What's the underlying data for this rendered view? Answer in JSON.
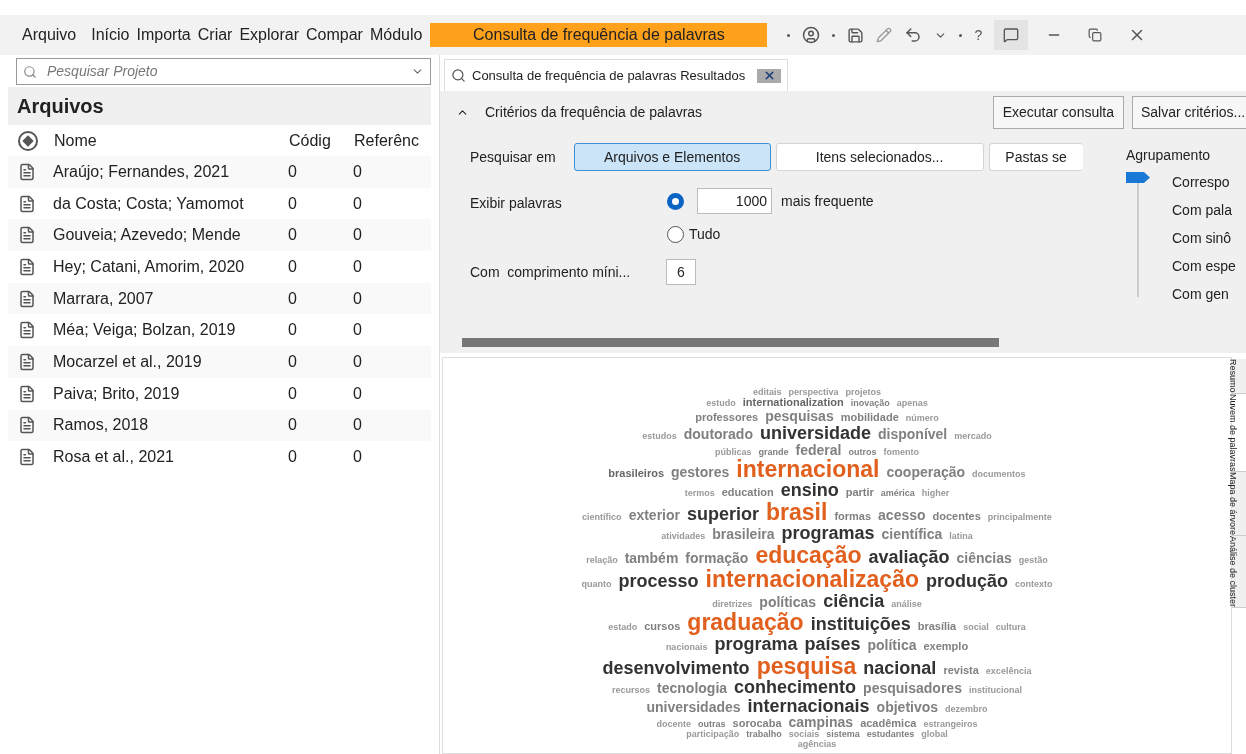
{
  "menu": [
    {
      "label": "Arquivo"
    },
    {
      "label": "Início"
    },
    {
      "label": "Importa"
    },
    {
      "label": "Criar"
    },
    {
      "label": "Explorar"
    },
    {
      "label": "Compar"
    },
    {
      "label": "Módulo"
    }
  ],
  "context_tab": {
    "label": "Consulta de frequência de palavras",
    "selected": true
  },
  "help": "?",
  "search": {
    "placeholder": "Pesquisar Projeto"
  },
  "section_title": "Arquivos",
  "table": {
    "columns": [
      "Nome",
      "Códig",
      "Referênc"
    ],
    "rows": [
      {
        "name": "Araújo; Fernandes, 2021",
        "codes": "0",
        "references": "0"
      },
      {
        "name": "da Costa; Costa; Yamomot",
        "codes": "0",
        "references": "0"
      },
      {
        "name": "Gouveia; Azevedo; Mende",
        "codes": "0",
        "references": "0"
      },
      {
        "name": "Hey; Catani, Amorim, 2020",
        "codes": "0",
        "references": "0"
      },
      {
        "name": "Marrara, 2007",
        "codes": "0",
        "references": "0"
      },
      {
        "name": "Méa; Veiga; Bolzan, 2019",
        "codes": "0",
        "references": "0"
      },
      {
        "name": "Mocarzel et al., 2019",
        "codes": "0",
        "references": "0"
      },
      {
        "name": "Paiva; Brito, 2019",
        "codes": "0",
        "references": "0"
      },
      {
        "name": "Ramos, 2018",
        "codes": "0",
        "references": "0"
      },
      {
        "name": "Rosa et al., 2021",
        "codes": "0",
        "references": "0"
      }
    ]
  },
  "doc_tab": {
    "label": "Consulta de frequência de palavras Resultados",
    "selected": true
  },
  "criteria": {
    "title": "Critérios da frequência de palavras",
    "expanded": true,
    "run_button": "Executar consulta",
    "save_button": "Salvar critérios...",
    "search_in": {
      "label": "Pesquisar em",
      "options": [
        {
          "label": "Arquivos e Elementos",
          "selected": true
        },
        {
          "label": "Itens selecionados...",
          "selected": false
        },
        {
          "label": "Pastas se",
          "selected": false
        }
      ]
    },
    "display": {
      "label": "Exibir palavras",
      "options": [
        {
          "label": "mais frequente",
          "selected": true,
          "value": "1000"
        },
        {
          "label": "Tudo",
          "selected": false
        }
      ]
    },
    "min_length": {
      "label": "Com  comprimento míni...",
      "value": "6"
    },
    "grouping": {
      "label": "Agrupamento",
      "options": [
        {
          "label": "Correspo",
          "selected": true
        },
        {
          "label": "Com pala",
          "selected": false
        },
        {
          "label": "Com sinô",
          "selected": false
        },
        {
          "label": "Com espe",
          "selected": false
        },
        {
          "label": "Com gen",
          "selected": false
        }
      ]
    }
  },
  "word_cloud": {
    "rows": [
      {
        "words": [
          {
            "text": "editais",
            "kind": "xs",
            "color": "#999999"
          },
          {
            "text": "perspectiva",
            "kind": "xs",
            "color": "#999999"
          },
          {
            "text": "projetos",
            "kind": "xs",
            "color": "#999999"
          }
        ]
      },
      {
        "words": [
          {
            "text": "estudo",
            "kind": "xs",
            "color": "#999999"
          },
          {
            "text": "internationalization",
            "kind": "s",
            "color": "#666666"
          },
          {
            "text": "inovação",
            "kind": "xs",
            "color": "#808080"
          },
          {
            "text": "apenas",
            "kind": "xs",
            "color": "#999999"
          }
        ]
      },
      {
        "words": [
          {
            "text": "professores",
            "kind": "s",
            "color": "#808080"
          },
          {
            "text": "pesquisas",
            "kind": "m",
            "color": "#808080"
          },
          {
            "text": "mobilidade",
            "kind": "s",
            "color": "#808080"
          },
          {
            "text": "número",
            "kind": "xs",
            "color": "#999999"
          }
        ]
      },
      {
        "words": [
          {
            "text": "estudos",
            "kind": "xs",
            "color": "#999999"
          },
          {
            "text": "doutorado",
            "kind": "m",
            "color": "#808080"
          },
          {
            "text": "universidade",
            "kind": "l",
            "color": "#333333"
          },
          {
            "text": "disponível",
            "kind": "m",
            "color": "#808080"
          },
          {
            "text": "mercado",
            "kind": "xs",
            "color": "#999999"
          }
        ]
      },
      {
        "words": [
          {
            "text": "públicas",
            "kind": "xs",
            "color": "#999999"
          },
          {
            "text": "grande",
            "kind": "xs",
            "color": "#808080"
          },
          {
            "text": "federal",
            "kind": "m",
            "color": "#808080"
          },
          {
            "text": "outros",
            "kind": "xs",
            "color": "#808080"
          },
          {
            "text": "fomento",
            "kind": "xs",
            "color": "#999999"
          }
        ]
      },
      {
        "words": [
          {
            "text": "brasileiros",
            "kind": "s",
            "color": "#666666"
          },
          {
            "text": "gestores",
            "kind": "m",
            "color": "#808080"
          },
          {
            "text": "internacional",
            "kind": "xl",
            "color": "#e2601e"
          },
          {
            "text": "cooperação",
            "kind": "m",
            "color": "#808080"
          },
          {
            "text": "documentos",
            "kind": "xs",
            "color": "#999999"
          }
        ]
      },
      {
        "words": [
          {
            "text": "termos",
            "kind": "xs",
            "color": "#999999"
          },
          {
            "text": "education",
            "kind": "s",
            "color": "#808080"
          },
          {
            "text": "ensino",
            "kind": "l",
            "color": "#333333"
          },
          {
            "text": "partir",
            "kind": "s",
            "color": "#808080"
          },
          {
            "text": "américa",
            "kind": "xs",
            "color": "#808080"
          },
          {
            "text": "higher",
            "kind": "xs",
            "color": "#999999"
          }
        ]
      },
      {
        "words": [
          {
            "text": "científico",
            "kind": "xs",
            "color": "#999999"
          },
          {
            "text": "exterior",
            "kind": "m",
            "color": "#808080"
          },
          {
            "text": "superior",
            "kind": "l",
            "color": "#333333"
          },
          {
            "text": "brasil",
            "kind": "xl",
            "color": "#e2601e"
          },
          {
            "text": "formas",
            "kind": "s",
            "color": "#808080"
          },
          {
            "text": "acesso",
            "kind": "m",
            "color": "#808080"
          },
          {
            "text": "docentes",
            "kind": "s",
            "color": "#808080"
          },
          {
            "text": "principalmente",
            "kind": "xs",
            "color": "#999999"
          }
        ]
      },
      {
        "words": [
          {
            "text": "atividades",
            "kind": "xs",
            "color": "#999999"
          },
          {
            "text": "brasileira",
            "kind": "m",
            "color": "#808080"
          },
          {
            "text": "programas",
            "kind": "l",
            "color": "#333333"
          },
          {
            "text": "científica",
            "kind": "m",
            "color": "#808080"
          },
          {
            "text": "latina",
            "kind": "xs",
            "color": "#999999"
          }
        ]
      },
      {
        "words": [
          {
            "text": "relação",
            "kind": "xs",
            "color": "#999999"
          },
          {
            "text": "também",
            "kind": "m",
            "color": "#808080"
          },
          {
            "text": "formação",
            "kind": "m",
            "color": "#808080"
          },
          {
            "text": "educação",
            "kind": "xl",
            "color": "#e2601e"
          },
          {
            "text": "avaliação",
            "kind": "l",
            "color": "#333333"
          },
          {
            "text": "ciências",
            "kind": "m",
            "color": "#808080"
          },
          {
            "text": "gestão",
            "kind": "xs",
            "color": "#999999"
          }
        ]
      },
      {
        "words": [
          {
            "text": "quanto",
            "kind": "xs",
            "color": "#999999"
          },
          {
            "text": "processo",
            "kind": "l",
            "color": "#333333"
          },
          {
            "text": "internacionalização",
            "kind": "xl",
            "color": "#e2601e"
          },
          {
            "text": "produção",
            "kind": "l",
            "color": "#333333"
          },
          {
            "text": "contexto",
            "kind": "xs",
            "color": "#999999"
          }
        ]
      },
      {
        "words": [
          {
            "text": "diretrizes",
            "kind": "xs",
            "color": "#999999"
          },
          {
            "text": "políticas",
            "kind": "m",
            "color": "#808080"
          },
          {
            "text": "ciência",
            "kind": "l",
            "color": "#333333"
          },
          {
            "text": "análise",
            "kind": "xs",
            "color": "#999999"
          }
        ]
      },
      {
        "words": [
          {
            "text": "estado",
            "kind": "xs",
            "color": "#999999"
          },
          {
            "text": "cursos",
            "kind": "s",
            "color": "#808080"
          },
          {
            "text": "graduação",
            "kind": "xl",
            "color": "#e2601e"
          },
          {
            "text": "instituições",
            "kind": "l",
            "color": "#333333"
          },
          {
            "text": "brasília",
            "kind": "s",
            "color": "#808080"
          },
          {
            "text": "social",
            "kind": "xs",
            "color": "#999999"
          },
          {
            "text": "cultura",
            "kind": "xs",
            "color": "#999999"
          }
        ]
      },
      {
        "words": [
          {
            "text": "nacionais",
            "kind": "xs",
            "color": "#999999"
          },
          {
            "text": "programa",
            "kind": "l",
            "color": "#333333"
          },
          {
            "text": "países",
            "kind": "l",
            "color": "#333333"
          },
          {
            "text": "política",
            "kind": "m",
            "color": "#808080"
          },
          {
            "text": "exemplo",
            "kind": "s",
            "color": "#808080"
          }
        ]
      },
      {
        "words": [
          {
            "text": "desenvolvimento",
            "kind": "l",
            "color": "#333333"
          },
          {
            "text": "pesquisa",
            "kind": "xl",
            "color": "#e2601e"
          },
          {
            "text": "nacional",
            "kind": "l",
            "color": "#333333"
          },
          {
            "text": "revista",
            "kind": "s",
            "color": "#808080"
          },
          {
            "text": "excelência",
            "kind": "xs",
            "color": "#999999"
          }
        ]
      },
      {
        "words": [
          {
            "text": "recursos",
            "kind": "xs",
            "color": "#999999"
          },
          {
            "text": "tecnologia",
            "kind": "m",
            "color": "#808080"
          },
          {
            "text": "conhecimento",
            "kind": "l",
            "color": "#333333"
          },
          {
            "text": "pesquisadores",
            "kind": "m",
            "color": "#808080"
          },
          {
            "text": "institucional",
            "kind": "xs",
            "color": "#999999"
          }
        ]
      },
      {
        "words": [
          {
            "text": "universidades",
            "kind": "m",
            "color": "#808080"
          },
          {
            "text": "internacionais",
            "kind": "l",
            "color": "#333333"
          },
          {
            "text": "objetivos",
            "kind": "m",
            "color": "#808080"
          },
          {
            "text": "dezembro",
            "kind": "xs",
            "color": "#999999"
          }
        ]
      },
      {
        "words": [
          {
            "text": "docente",
            "kind": "xs",
            "color": "#999999"
          },
          {
            "text": "outras",
            "kind": "xs",
            "color": "#808080"
          },
          {
            "text": "sorocaba",
            "kind": "s",
            "color": "#808080"
          },
          {
            "text": "campinas",
            "kind": "m",
            "color": "#808080"
          },
          {
            "text": "acadêmica",
            "kind": "s",
            "color": "#808080"
          },
          {
            "text": "estrangeiros",
            "kind": "xs",
            "color": "#999999"
          }
        ]
      },
      {
        "words": [
          {
            "text": "participação",
            "kind": "xs",
            "color": "#999999"
          },
          {
            "text": "trabalho",
            "kind": "xs",
            "color": "#808080"
          },
          {
            "text": "sociais",
            "kind": "xs",
            "color": "#999999"
          },
          {
            "text": "sistema",
            "kind": "xs",
            "color": "#808080"
          },
          {
            "text": "estudantes",
            "kind": "xs",
            "color": "#808080"
          },
          {
            "text": "global",
            "kind": "xs",
            "color": "#999999"
          }
        ]
      },
      {
        "words": [
          {
            "text": "agências",
            "kind": "xs",
            "color": "#999999"
          }
        ]
      }
    ]
  },
  "view_tabs": [
    {
      "label": "Resumo",
      "selected": false
    },
    {
      "label": "Nuvem de palavras",
      "selected": true
    },
    {
      "label": "Mapa de árvore",
      "selected": false
    },
    {
      "label": "Análise de cluster",
      "selected": false
    }
  ]
}
